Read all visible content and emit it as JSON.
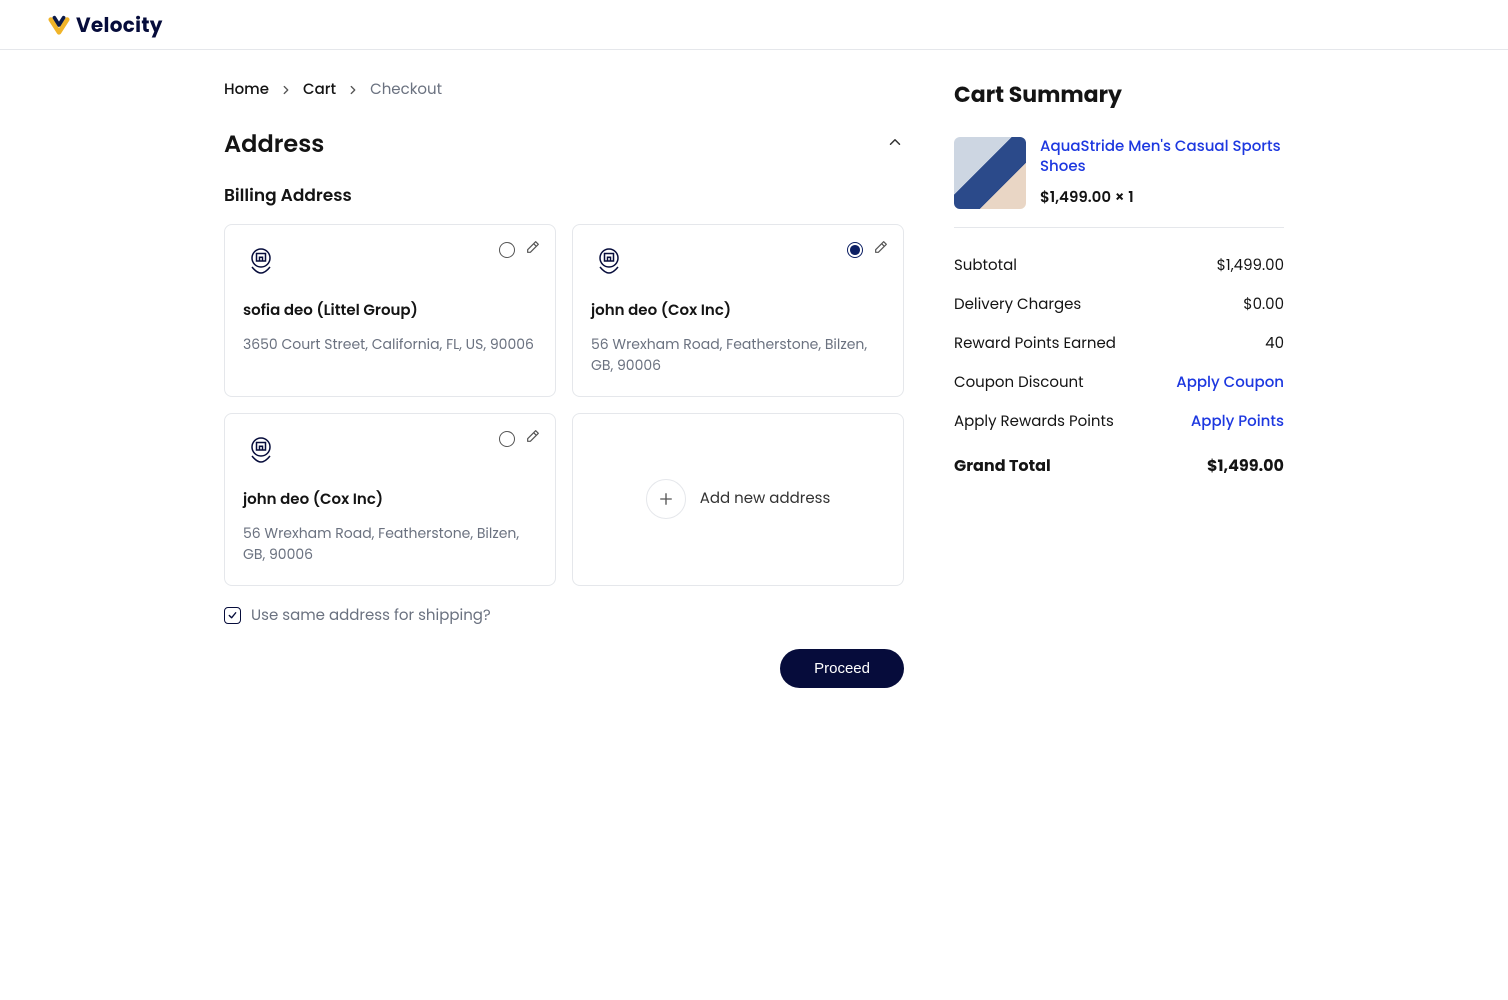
{
  "brand": "Velocity",
  "breadcrumb": {
    "home": "Home",
    "cart": "Cart",
    "current": "Checkout"
  },
  "address": {
    "heading": "Address",
    "billing_heading": "Billing Address",
    "cards": [
      {
        "name": "sofia deo (Littel Group)",
        "line": "3650 Court Street, California, FL, US, 90006",
        "selected": false
      },
      {
        "name": "john deo (Cox Inc)",
        "line": "56 Wrexham Road, Featherstone, Bilzen, GB, 90006",
        "selected": true
      },
      {
        "name": "john deo (Cox Inc)",
        "line": "56 Wrexham Road, Featherstone, Bilzen, GB, 90006",
        "selected": false
      }
    ],
    "add_label": "Add new address",
    "same_for_shipping": "Use same address for shipping?",
    "same_checked": true,
    "proceed": "Proceed"
  },
  "summary": {
    "heading": "Cart Summary",
    "item": {
      "title": "AquaStride Men's Casual Sports Shoes",
      "price_line": "$1,499.00 × 1"
    },
    "rows": {
      "subtotal": {
        "label": "Subtotal",
        "value": "$1,499.00"
      },
      "delivery": {
        "label": "Delivery Charges",
        "value": "$0.00"
      },
      "rewards_earned": {
        "label": "Reward Points Earned",
        "value": "40"
      },
      "coupon": {
        "label": "Coupon Discount",
        "action": "Apply Coupon"
      },
      "apply_rewards": {
        "label": "Apply Rewards Points",
        "action": "Apply Points"
      },
      "grand_total": {
        "label": "Grand Total",
        "value": "$1,499.00"
      }
    }
  }
}
